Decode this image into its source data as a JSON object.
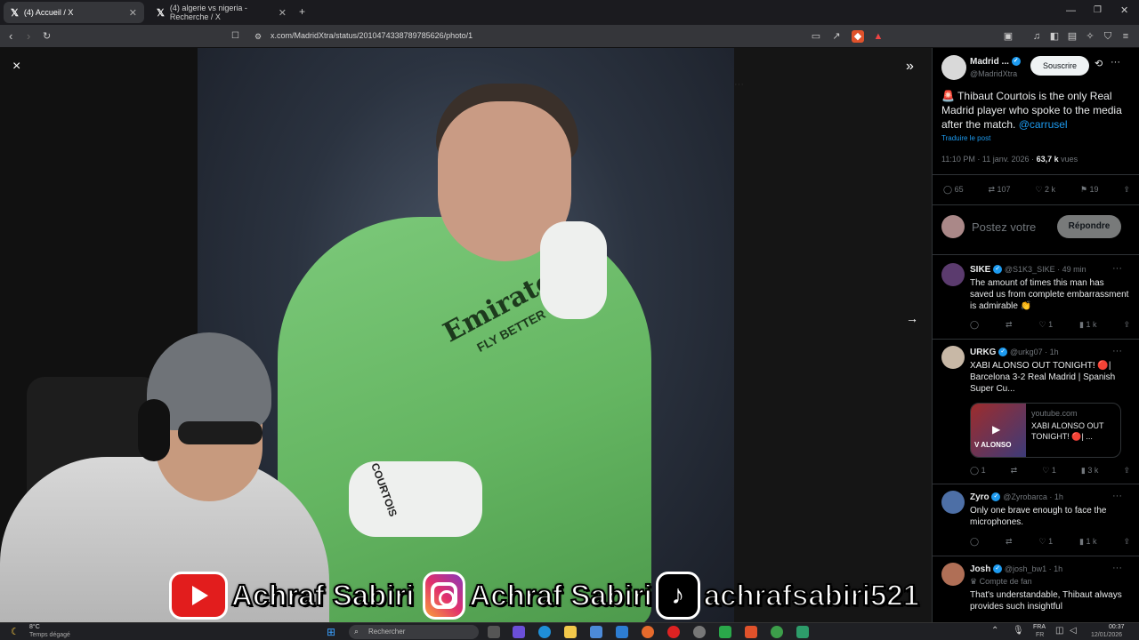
{
  "browser": {
    "tabs": [
      {
        "title": "(4) Accueil / X",
        "active": true
      },
      {
        "title": "(4) algerie vs nigeria - Recherche / X",
        "active": false
      }
    ],
    "new_tab": "+",
    "url": "x.com/MadridXtra/status/2010474338789785626/photo/1",
    "window_controls": [
      "minimize-icon",
      "restore-icon",
      "close-icon"
    ]
  },
  "media_viewer": {
    "close": "×",
    "expand": "»",
    "next": "→",
    "photo_text": {
      "sponsor": "Emirates",
      "sponsor_sub": "FLY BETTER",
      "glove_text": "COURTOIS"
    }
  },
  "overlay": {
    "youtube_handle": "Achraf Sabiri",
    "instagram_handle": "Achraf Sabiri",
    "tiktok_handle": "achrafsabiri521"
  },
  "tweet": {
    "author_name": "Madrid ...",
    "author_handle": "@MadridXtra",
    "follow_label": "Souscrire",
    "text": "🚨 Thibaut Courtois is the only Real Madrid player who spoke to the media after the match.",
    "mention": "@carrusel",
    "translate": "Traduire le post",
    "time": "11:10 PM · 11 janv. 2026 · ",
    "views": "63,7 k",
    "views_label": "vues",
    "stats": {
      "replies": "65",
      "reposts": "107",
      "likes": "2 k",
      "bookmarks": "19"
    },
    "reply_placeholder": "Postez votre",
    "reply_button": "Répondre"
  },
  "replies": [
    {
      "name": "SIKE",
      "handle": "@S1K3_SIKE · 49 min",
      "text": "The amount of times this man has saved us from complete embarrassment is admirable 👏",
      "stats": [
        "",
        "",
        "1",
        "1 k",
        ""
      ]
    },
    {
      "name": "URKG",
      "handle": "@urkg07 · 1h",
      "text": "XABI ALONSO OUT TONIGHT! 🔴| Barcelona 3-2 Real Madrid | Spanish Super Cu...",
      "card_domain": "youtube.com",
      "card_title": "XABI ALONSO OUT TONIGHT! 🔴| ...",
      "card_thumb": "V ALONSO",
      "stats": [
        "1",
        "",
        "1",
        "3 k",
        ""
      ]
    },
    {
      "name": "Zyro",
      "handle": "@Zyrobarca · 1h",
      "text": "Only one brave enough to face the microphones.",
      "stats": [
        "",
        "",
        "1",
        "1 k",
        ""
      ]
    },
    {
      "name": "Josh",
      "handle": "@josh_bw1 · 1h",
      "label": "Compte de fan",
      "text": "That's understandable, Thibaut always provides such insightful",
      "stats": []
    }
  ],
  "taskbar": {
    "weather_temp": "8°C",
    "weather_desc": "Temps dégagé",
    "search_placeholder": "Rechercher",
    "lang": "FRA",
    "lang_sub": "FR",
    "time": "00:37",
    "date": "12/01/2026"
  }
}
